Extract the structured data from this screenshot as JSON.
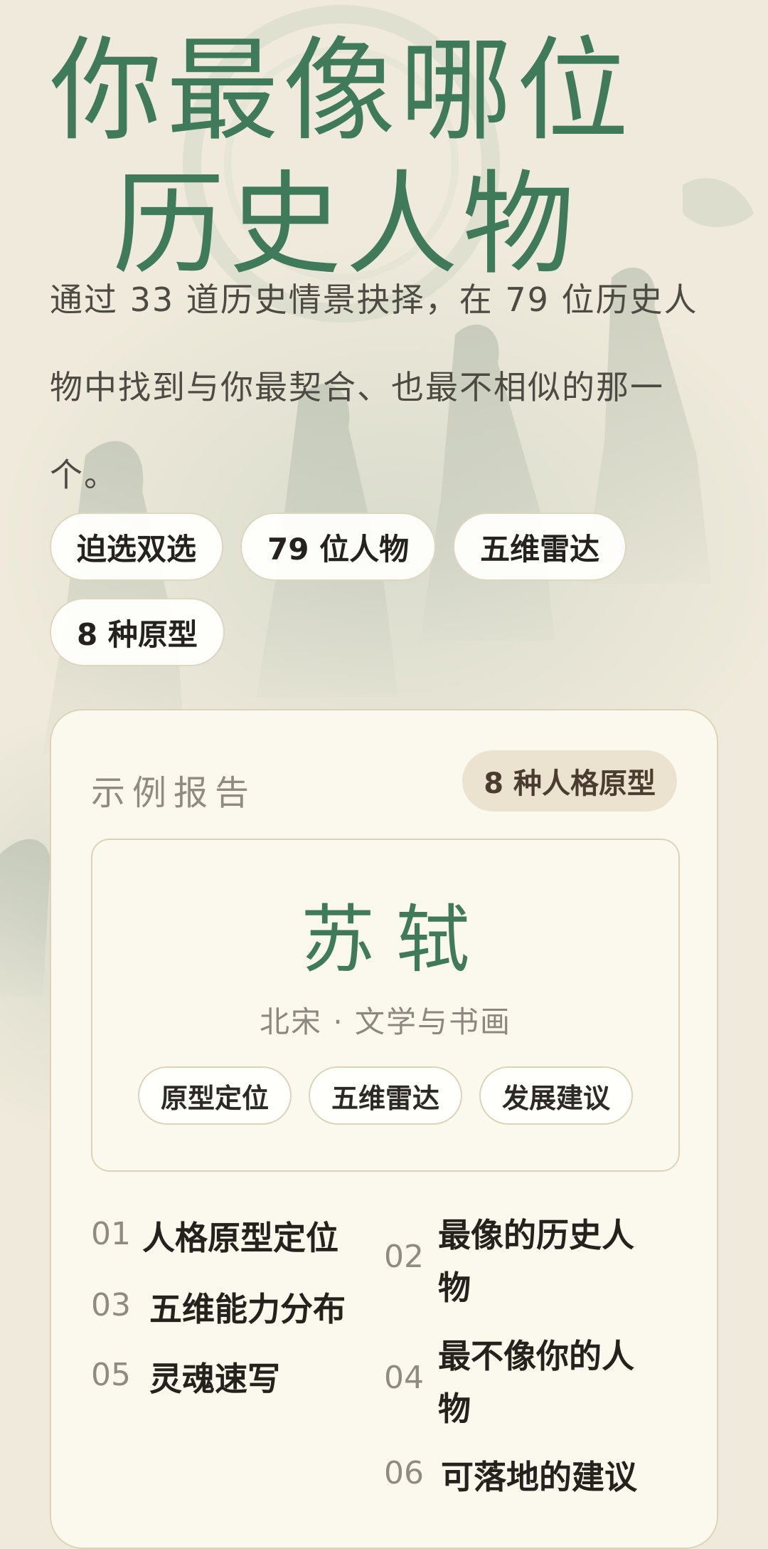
{
  "hero": {
    "title_line1": "你最像哪位",
    "title_line2": "历史人物",
    "subtitle": "通过 33 道历史情景抉择，在 79 位历史人物中找到与你最契合、也最不相似的那一个。"
  },
  "chips": [
    "迫选双选",
    "79 位人物",
    "五维雷达",
    "8 种原型"
  ],
  "report": {
    "label": "示例报告",
    "badge": "8 种人格原型",
    "person": {
      "name": "苏轼",
      "meta": "北宋 · 文学与书画"
    },
    "features": [
      "原型定位",
      "五维雷达",
      "发展建议"
    ],
    "sections": [
      {
        "num": "01",
        "title": "人格原型定位"
      },
      {
        "num": "02",
        "title": "最像的历史人物"
      },
      {
        "num": "03",
        "title": "五维能力分布"
      },
      {
        "num": "04",
        "title": "最不像你的人物"
      },
      {
        "num": "05",
        "title": "灵魂速写"
      },
      {
        "num": "06",
        "title": "可落地的建议"
      }
    ]
  },
  "colors": {
    "background": "#efeadb",
    "accent_green": "#3f7b5a",
    "card": "#fbf9ee",
    "badge": "#ebe3d0"
  }
}
